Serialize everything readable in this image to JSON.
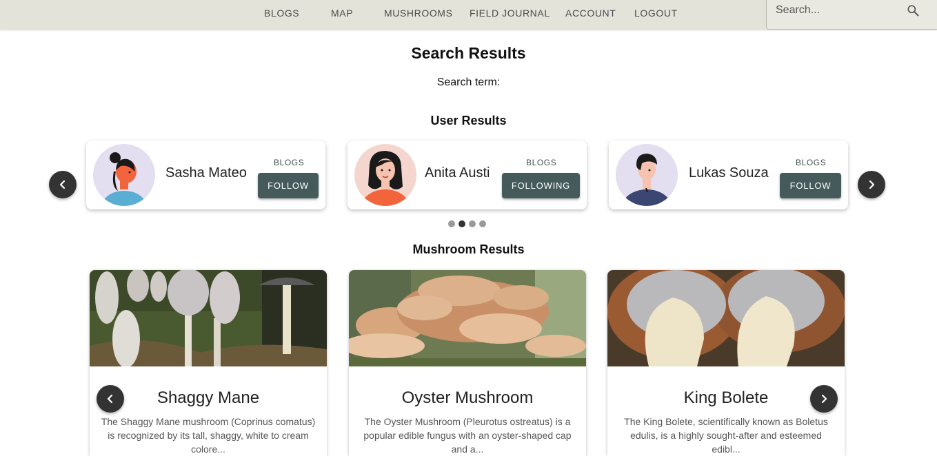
{
  "nav": {
    "items": [
      "BLOGS",
      "MAP",
      "MUSHROOMS",
      "FIELD JOURNAL",
      "ACCOUNT",
      "LOGOUT"
    ],
    "search_placeholder": "Search..."
  },
  "page": {
    "title": "Search Results",
    "search_term_label": "Search term:"
  },
  "users": {
    "heading": "User Results",
    "cards": [
      {
        "name": "Sasha Mateo",
        "blogs_label": "BLOGS",
        "follow_label": "FOLLOW",
        "avatar_bg": "#e3def0",
        "shirt": "#5aaed4"
      },
      {
        "name": "Anita Austi",
        "blogs_label": "BLOGS",
        "follow_label": "FOLLOWING",
        "avatar_bg": "#f4d6cf",
        "shirt": "#f2643c"
      },
      {
        "name": "Lukas Souza",
        "blogs_label": "BLOGS",
        "follow_label": "FOLLOW",
        "avatar_bg": "#e3def0",
        "shirt": "#3b4672"
      }
    ],
    "pages": 4,
    "active_page": 2
  },
  "mushrooms": {
    "heading": "Mushroom Results",
    "cards": [
      {
        "title": "Shaggy Mane",
        "desc": "The Shaggy Mane mushroom (Coprinus comatus) is recognized by its tall, shaggy, white to cream colore..."
      },
      {
        "title": "Oyster Mushroom",
        "desc": "The Oyster Mushroom (Pleurotus ostreatus) is a popular edible fungus with an oyster-shaped cap and a..."
      },
      {
        "title": "King Bolete",
        "desc": "The King Bolete, scientifically known as Boletus edulis, is a highly sought-after and esteemed edibl..."
      }
    ]
  },
  "colors": {
    "topbar": "#e4e3da",
    "button": "#455a5a",
    "arrow_button": "#333333"
  }
}
